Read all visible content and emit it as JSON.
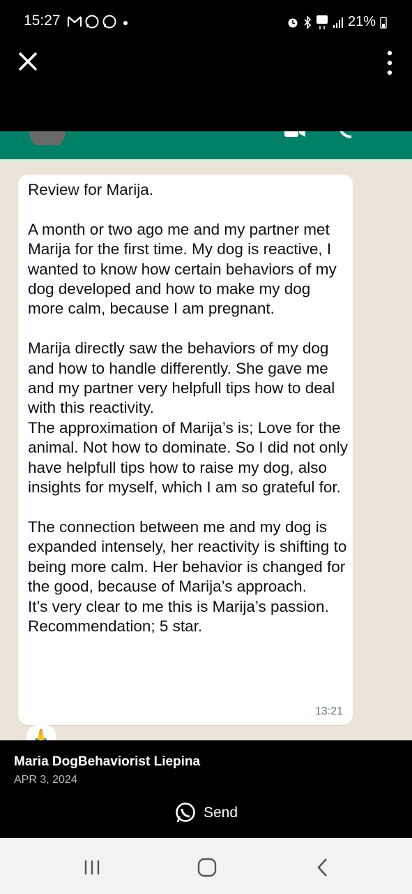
{
  "status_bar": {
    "time": "15:27",
    "battery": "21%",
    "left_icons": [
      "gmail-icon",
      "whatsapp-icon",
      "whatsapp-icon",
      "dot-icon"
    ],
    "right_icons": [
      "alarm-icon",
      "bluetooth-icon",
      "5g-icon",
      "signal-icon",
      "battery-icon"
    ]
  },
  "viewer": {
    "close_icon": "close-icon",
    "menu_icon": "more-vert-icon"
  },
  "screenshot": {
    "header_color": "#008069",
    "message": {
      "text": "Review for Marija.\n\nA month or two ago me and my partner met Marija for the first time. My dog is reactive, I wanted to know how certain behaviors of my dog developed and how to make my dog more calm, because I am pregnant.\n\nMarija directly saw the behaviors of my dog and how to handle differently. She gave me and my partner very helpfull tips how to deal with this reactivity.\nThe approximation of Marija’s is; Love for the animal. Not how to dominate. So I did not only have helpfull tips how to raise my dog, also insights for myself, which I am so grateful for.\n\nThe connection between me and my dog is expanded intensely, her reactivity is shifting to being more calm. Her behavior is changed for the good, because of Marija’s approach.\nIt’s very clear to me this is Marija’s passion.\nRecommendation; 5 star.",
      "time": "13:21",
      "reaction": "🙏"
    }
  },
  "caption": {
    "sender": "Maria DogBehaviorist Liepina",
    "date": "APR 3, 2024",
    "send_label": "Send"
  },
  "nav": {
    "buttons": [
      "recents-icon",
      "home-icon",
      "back-icon"
    ]
  }
}
